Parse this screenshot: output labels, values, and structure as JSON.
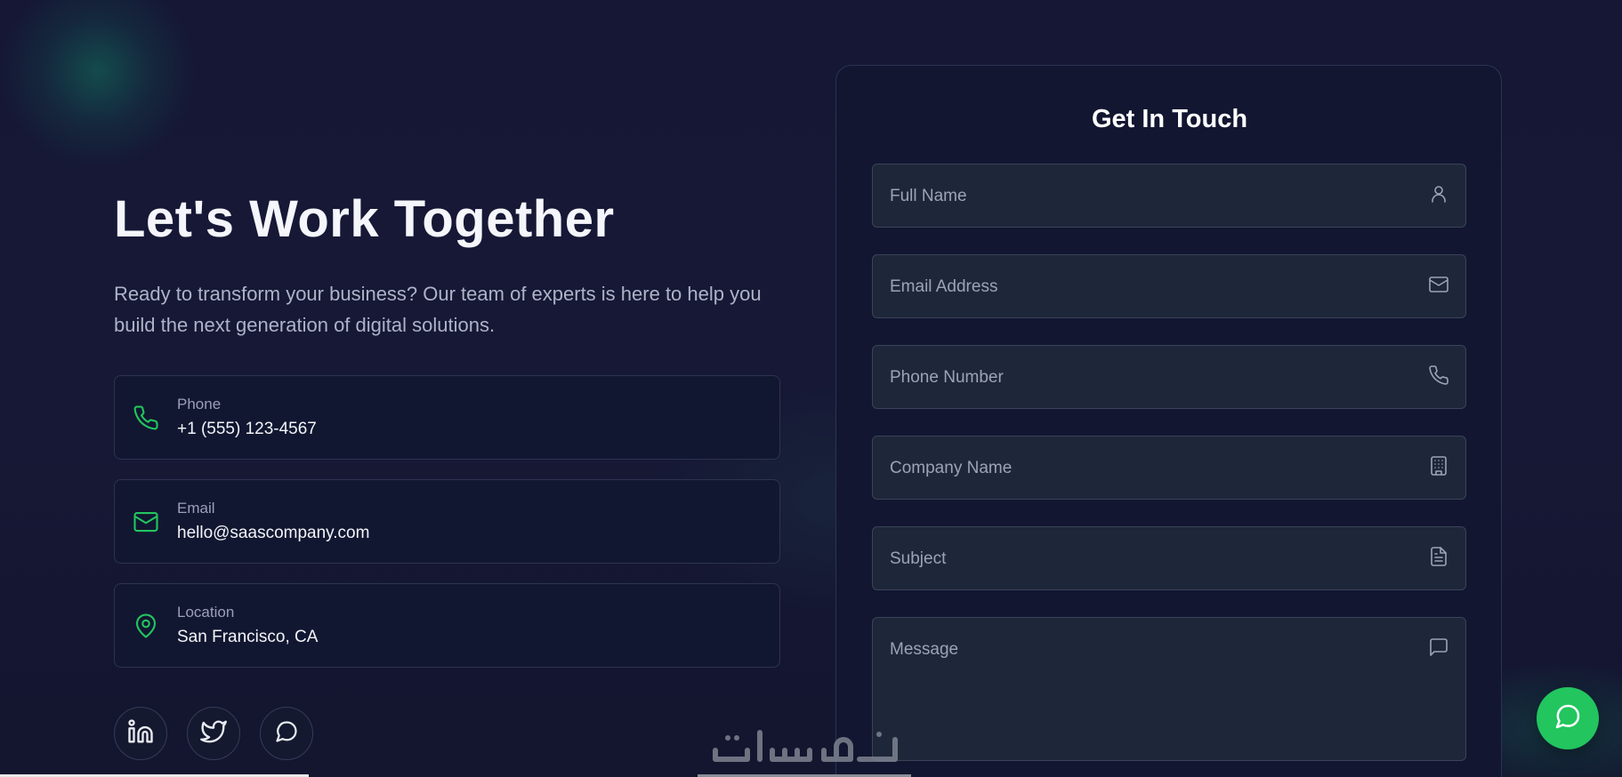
{
  "hero": {
    "title": "Let's Work Together",
    "subtitle": "Ready to transform your business? Our team of experts is here to help you build the next generation of digital solutions."
  },
  "contact_info": [
    {
      "icon": "phone-icon",
      "label": "Phone",
      "value": "+1 (555) 123-4567"
    },
    {
      "icon": "mail-icon",
      "label": "Email",
      "value": "hello@saascompany.com"
    },
    {
      "icon": "map-pin-icon",
      "label": "Location",
      "value": "San Francisco, CA"
    }
  ],
  "social": [
    "linkedin-icon",
    "twitter-icon",
    "chat-bubble-icon"
  ],
  "form": {
    "title": "Get In Touch",
    "fields": [
      {
        "placeholder": "Full Name",
        "icon": "user-icon"
      },
      {
        "placeholder": "Email Address",
        "icon": "mail-icon"
      },
      {
        "placeholder": "Phone Number",
        "icon": "phone-icon"
      },
      {
        "placeholder": "Company Name",
        "icon": "building-icon"
      },
      {
        "placeholder": "Subject",
        "icon": "document-icon"
      },
      {
        "placeholder": "Message",
        "icon": "message-square-icon"
      }
    ]
  },
  "watermark": "خمسات",
  "colors": {
    "background": "#141633",
    "card": "#121731",
    "accent": "#22c55e",
    "field": "#1e273a"
  }
}
